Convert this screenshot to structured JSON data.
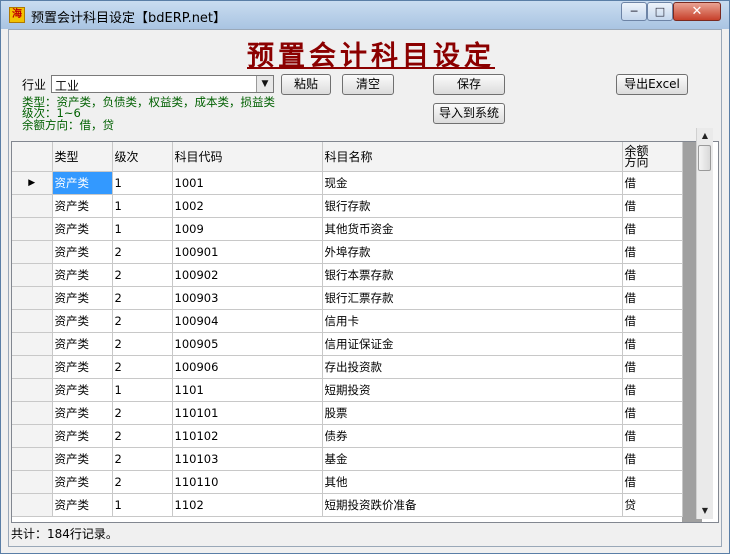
{
  "window": {
    "title": "预置会计科目设定【bdERP.net】",
    "app_icon_text": "海",
    "min_glyph": "─",
    "max_glyph": "□",
    "close_glyph": "✕"
  },
  "form": {
    "heading": "预置会计科目设定",
    "industry_label": "行业",
    "industry_value": "工业",
    "dropdown_glyph": "▼",
    "paste_button": "粘贴",
    "clear_button": "清空",
    "save_button": "保存",
    "import_button": "导入到系统",
    "export_button": "导出Excel",
    "hint_types": "类型：资产类，负债类，权益类，成本类，损益类",
    "hint_levels": "级次：1~6",
    "hint_direction": "余额方向：借，贷"
  },
  "grid": {
    "columns": [
      "类型",
      "级次",
      "科目代码",
      "科目名称",
      "余额方向"
    ],
    "balance_header_line1": "余额",
    "balance_header_line2": "方向",
    "current_row_glyph": "▶",
    "rows": [
      [
        "资产类",
        "1",
        "1001",
        "现金",
        "借"
      ],
      [
        "资产类",
        "1",
        "1002",
        "银行存款",
        "借"
      ],
      [
        "资产类",
        "1",
        "1009",
        "其他货币资金",
        "借"
      ],
      [
        "资产类",
        "2",
        "100901",
        "外埠存款",
        "借"
      ],
      [
        "资产类",
        "2",
        "100902",
        "银行本票存款",
        "借"
      ],
      [
        "资产类",
        "2",
        "100903",
        "银行汇票存款",
        "借"
      ],
      [
        "资产类",
        "2",
        "100904",
        "信用卡",
        "借"
      ],
      [
        "资产类",
        "2",
        "100905",
        "信用证保证金",
        "借"
      ],
      [
        "资产类",
        "2",
        "100906",
        "存出投资款",
        "借"
      ],
      [
        "资产类",
        "1",
        "1101",
        "短期投资",
        "借"
      ],
      [
        "资产类",
        "2",
        "110101",
        "股票",
        "借"
      ],
      [
        "资产类",
        "2",
        "110102",
        "债券",
        "借"
      ],
      [
        "资产类",
        "2",
        "110103",
        "基金",
        "借"
      ],
      [
        "资产类",
        "2",
        "110110",
        "其他",
        "借"
      ],
      [
        "资产类",
        "1",
        "1102",
        "短期投资跌价准备",
        "贷"
      ]
    ]
  },
  "scrollbar": {
    "up_glyph": "▲",
    "down_glyph": "▼"
  },
  "status": {
    "text": "共计：184行记录。"
  }
}
